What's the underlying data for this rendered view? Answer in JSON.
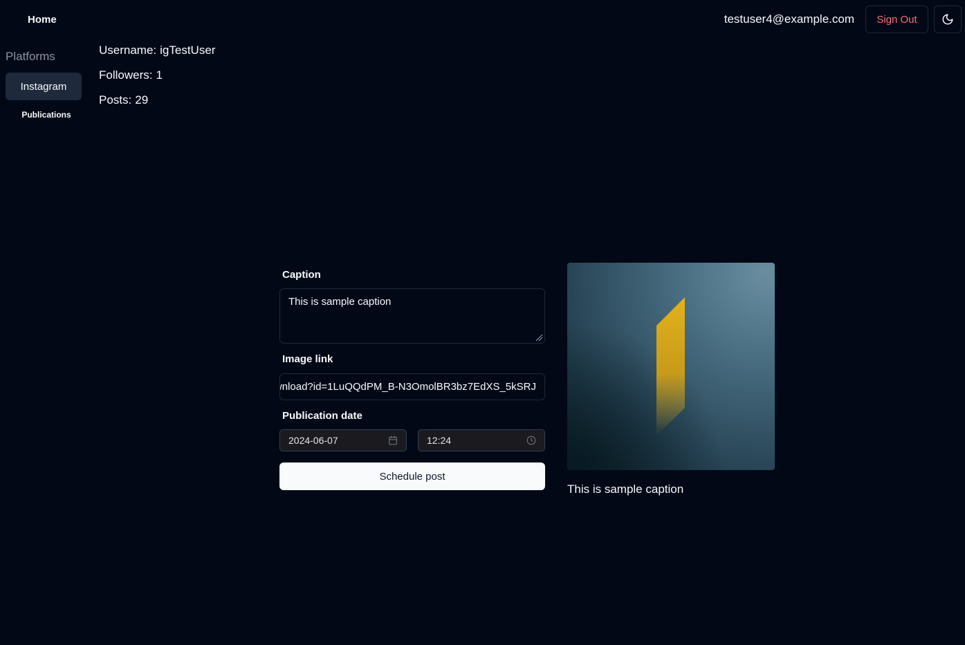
{
  "header": {
    "home_label": "Home",
    "user_email": "testuser4@example.com",
    "sign_out_label": "Sign Out",
    "theme_toggle_icon": "moon-icon"
  },
  "sidebar": {
    "heading": "Platforms",
    "items": [
      {
        "label": "Instagram",
        "active": true
      },
      {
        "label": "Publications",
        "active": false
      }
    ]
  },
  "profile": {
    "username_label": "Username:",
    "username": "igTestUser",
    "followers_label": "Followers:",
    "followers": "1",
    "posts_label": "Posts:",
    "posts": "29"
  },
  "form": {
    "caption_label": "Caption",
    "caption_value": "This is sample caption",
    "image_link_label": "Image link",
    "image_link_value": "wnload?id=1LuQQdPM_B-N3OmolBR3bz7EdXS_5kSRJ",
    "publication_date_label": "Publication date",
    "date_value": "2024-06-07",
    "time_value": "12:24",
    "submit_label": "Schedule post"
  },
  "preview": {
    "caption": "This is sample caption"
  },
  "colors": {
    "background": "#030817",
    "sign_out_text": "#f87171",
    "active_nav_bg": "#1e293b",
    "primary_button_bg": "#f8fafc",
    "accent_yellow": "#e3b21c"
  }
}
